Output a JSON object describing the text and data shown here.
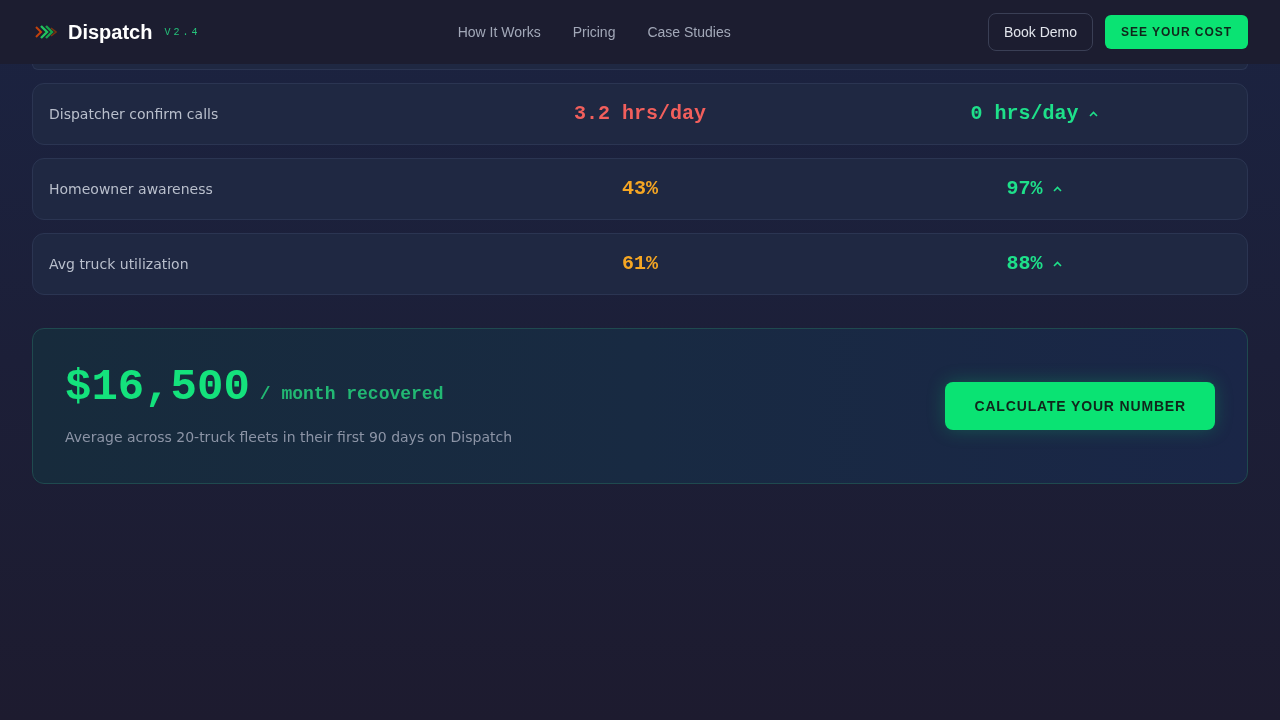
{
  "header": {
    "brand": "Dispatch",
    "version": "V2.4",
    "nav": [
      "How It Works",
      "Pricing",
      "Case Studies"
    ],
    "buttons": [
      {
        "label": "Book Demo",
        "kind": "outline"
      },
      {
        "label": "SEE YOUR COST",
        "kind": "primary"
      }
    ]
  },
  "comparison_rows": [
    {
      "label": "Dispatcher confirm calls",
      "before": {
        "text": "3.2 hrs/day",
        "color": "#f25f5c"
      },
      "after": {
        "text": "0 hrs/day",
        "color": "#1ee08a",
        "improved": true
      }
    },
    {
      "label": "Homeowner awareness",
      "before": {
        "text": "43%",
        "color": "#f5a623"
      },
      "after": {
        "text": "97%",
        "color": "#1ee08a",
        "improved": true
      }
    },
    {
      "label": "Avg truck utilization",
      "before": {
        "text": "61%",
        "color": "#f5a623"
      },
      "after": {
        "text": "88%",
        "color": "#1ee08a",
        "improved": true
      }
    }
  ],
  "summary": {
    "amount": "$16,500",
    "unit": "/ month recovered",
    "note": "Average across 20-truck fleets in their first 90 days on Dispatch",
    "button": "CALCULATE YOUR NUMBER"
  }
}
